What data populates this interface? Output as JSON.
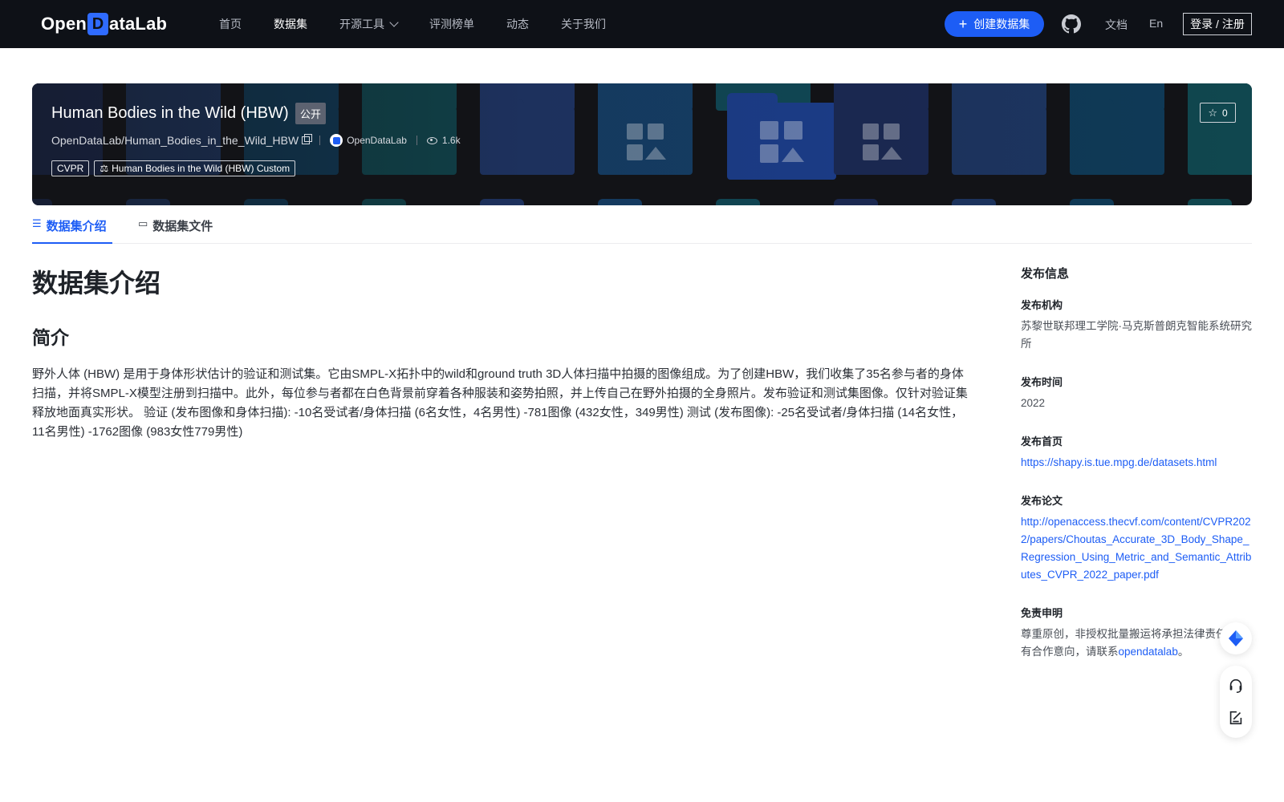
{
  "nav": {
    "logo_text": "OpenDataLab",
    "items": [
      {
        "label": "首页",
        "active": false
      },
      {
        "label": "数据集",
        "active": true
      },
      {
        "label": "开源工具",
        "active": false,
        "has_dropdown": true
      },
      {
        "label": "评测榜单",
        "active": false
      },
      {
        "label": "动态",
        "active": false
      },
      {
        "label": "关于我们",
        "active": false
      }
    ],
    "create_button": "创建数据集",
    "github_icon": "github-icon",
    "docs": "文档",
    "lang": "En",
    "login": "登录 / 注册",
    "accent_color": "#1d5df5"
  },
  "banner": {
    "title": "Human Bodies in the Wild (HBW)",
    "visibility": "公开",
    "path": "OpenDataLab/Human_Bodies_in_the_Wild_HBW",
    "org": "OpenDataLab",
    "views": "1.6k",
    "tags": [
      "CVPR",
      "Human Bodies in the Wild (HBW) Custom"
    ],
    "stars": "0"
  },
  "tabs": [
    {
      "label": "数据集介绍",
      "icon": "database-icon",
      "active": true
    },
    {
      "label": "数据集文件",
      "icon": "file-icon",
      "active": false
    }
  ],
  "main": {
    "heading": "数据集介绍",
    "subheading": "简介",
    "paragraph": "野外人体 (HBW) 是用于身体形状估计的验证和测试集。它由SMPL-X拓扑中的wild和ground truth 3D人体扫描中拍摄的图像组成。为了创建HBW，我们收集了35名参与者的身体扫描，并将SMPL-X模型注册到扫描中。此外，每位参与者都在白色背景前穿着各种服装和姿势拍照，并上传自己在野外拍摄的全身照片。发布验证和测试集图像。仅针对验证集释放地面真实形状。 验证 (发布图像和身体扫描): -10名受试者/身体扫描 (6名女性，4名男性) -781图像 (432女性，349男性) 测试 (发布图像): -25名受试者/身体扫描 (14名女性，11名男性) -1762图像 (983女性779男性)"
  },
  "sidebar": {
    "heading": "发布信息",
    "org_label": "发布机构",
    "org_value": "苏黎世联邦理工学院·马克斯普朗克智能系统研究所",
    "time_label": "发布时间",
    "time_value": "2022",
    "home_label": "发布首页",
    "home_value": "https://shapy.is.tue.mpg.de/datasets.html",
    "paper_label": "发布论文",
    "paper_value": "http://openaccess.thecvf.com/content/CVPR2022/papers/Choutas_Accurate_3D_Body_Shape_Regression_Using_Metric_and_Semantic_Attributes_CVPR_2022_paper.pdf",
    "disclaimer_label": "免责申明",
    "disclaimer_text_1": "尊重原创，非授权批量搬运将承担法律责任。如有合作意向，请联系",
    "disclaimer_link": "opendatalab",
    "disclaimer_text_2": "。"
  },
  "floating": [
    "rocket-icon",
    "headset-icon",
    "feedback-icon"
  ]
}
